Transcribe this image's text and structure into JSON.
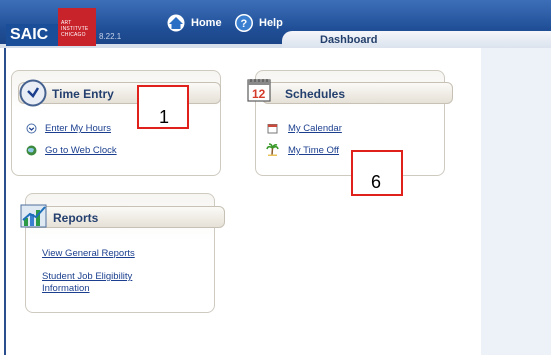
{
  "header": {
    "logo_text": "SAIC",
    "logo_sub": [
      "ART",
      "INSTITVTE",
      "CHICAGO"
    ],
    "version": "8.22.1",
    "home_label": "Home",
    "help_label": "Help",
    "tab_label": "Dashboard"
  },
  "panels": {
    "time_entry": {
      "title": "Time Entry",
      "links": [
        "Enter My Hours",
        "Go to Web Clock"
      ]
    },
    "schedules": {
      "title": "Schedules",
      "calendar_icon_text": "12",
      "links": [
        "My Calendar",
        "My Time Off"
      ]
    },
    "reports": {
      "title": "Reports",
      "links": [
        "View General Reports",
        "Student Job Eligibility",
        "Information"
      ]
    }
  },
  "callouts": [
    "1",
    "6"
  ],
  "colors": {
    "header": "#204f97",
    "link": "#1b3f8e",
    "callout_border": "#e0201a"
  }
}
